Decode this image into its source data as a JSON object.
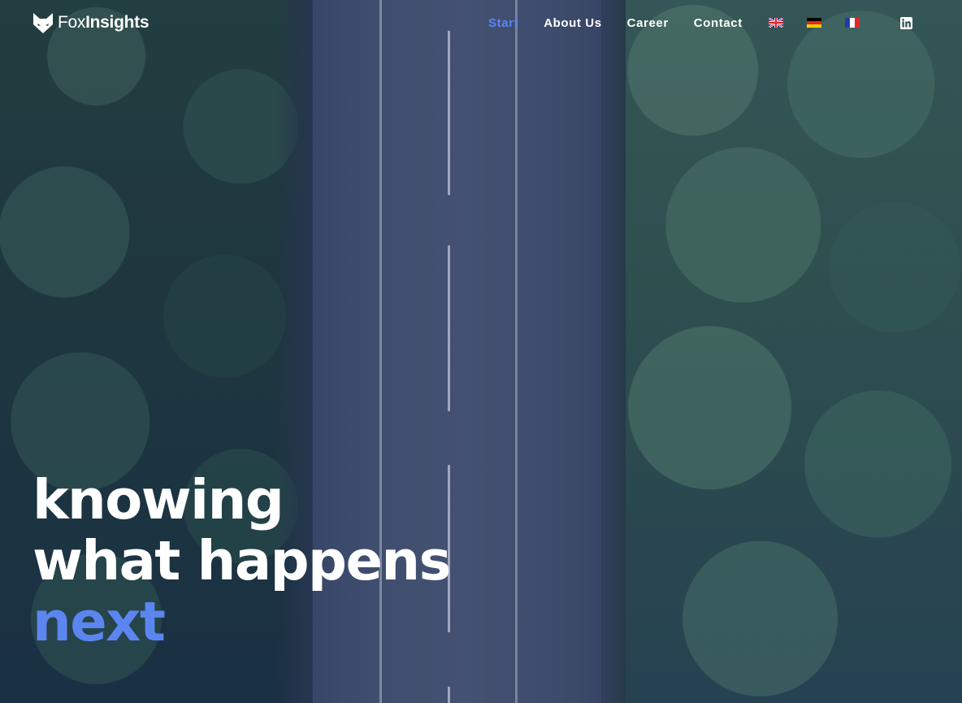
{
  "brand": {
    "name_light": "Fox",
    "name_bold": "Insights",
    "logo_icon": "fox-head-icon"
  },
  "nav": {
    "items": [
      {
        "label": "Start",
        "active": true
      },
      {
        "label": "About Us",
        "active": false
      },
      {
        "label": "Career",
        "active": false
      },
      {
        "label": "Contact",
        "active": false
      }
    ],
    "languages": [
      {
        "icon": "uk-flag-icon"
      },
      {
        "icon": "germany-flag-icon"
      },
      {
        "icon": "france-flag-icon"
      }
    ],
    "social_icon": "linkedin-icon"
  },
  "hero": {
    "line1": "knowing",
    "line2": "what happens",
    "line3": "next"
  },
  "colors": {
    "accent": "#5b86f0",
    "text": "#ffffff"
  }
}
